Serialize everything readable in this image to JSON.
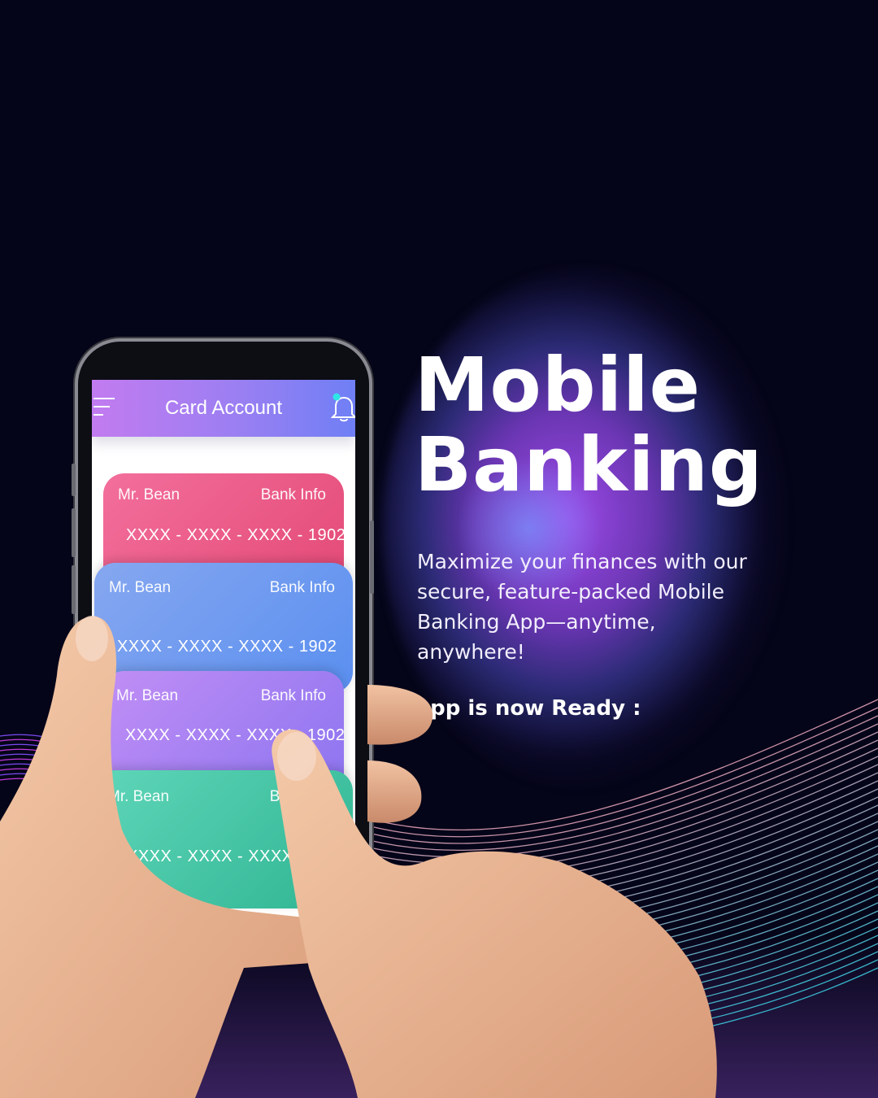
{
  "headline": {
    "line1": "Mobile",
    "line2": "Banking"
  },
  "description": "Maximize your finances with our secure, feature-packed Mobile Banking App—anytime, anywhere!",
  "cta_text": "App is now Ready :",
  "phone_app": {
    "header_title": "Card Account",
    "menu_icon": "hamburger-menu-icon",
    "bell_icon": "notification-bell-icon",
    "cards": [
      {
        "name": "Mr. Bean",
        "label": "Bank Info",
        "number": "XXXX - XXXX - XXXX - 1902",
        "color": "#e44a77"
      },
      {
        "name": "Mr. Bean",
        "label": "Bank Info",
        "number": "XXXX - XXXX - XXXX - 1902",
        "color": "#5a8ff0"
      },
      {
        "name": "Mr. Bean",
        "label": "Bank Info",
        "number": "XXXX - XXXX - XXXX - 1902",
        "color": "#8b74f0"
      },
      {
        "name": "Mr. Bean",
        "label": "Bank Info",
        "number": "XXXX - XXXX - XXXX - 1902",
        "color": "#2fb592"
      }
    ]
  },
  "colors": {
    "background": "#050519",
    "glow": "#a850f5",
    "accent_dot": "#2ee6e6"
  }
}
